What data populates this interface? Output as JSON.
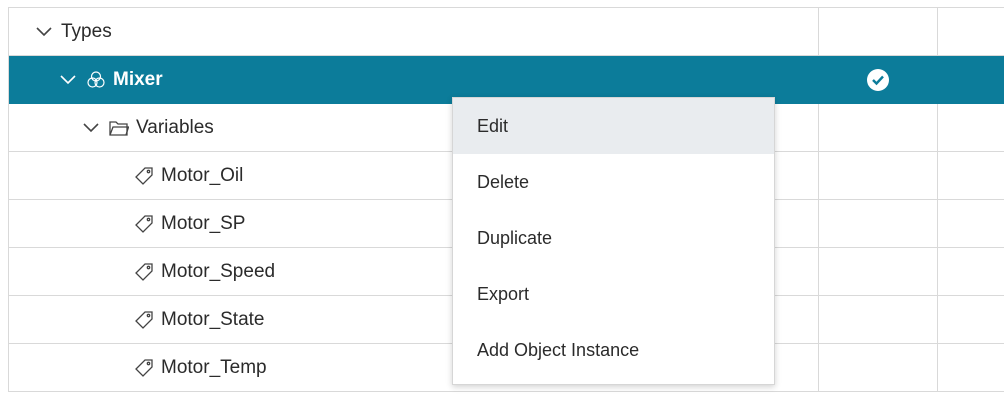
{
  "tree": {
    "rows": [
      {
        "label": "Types",
        "icon": "chevron-down-icon",
        "expanded": true
      },
      {
        "label": "Mixer",
        "icon": "object-type-icon",
        "expanded": true,
        "selected": true,
        "status": "check-circle-icon"
      },
      {
        "label": "Variables",
        "icon": "folder-icon",
        "expanded": true
      },
      {
        "label": "Motor_Oil",
        "icon": "tag-icon"
      },
      {
        "label": "Motor_SP",
        "icon": "tag-icon"
      },
      {
        "label": "Motor_Speed",
        "icon": "tag-icon"
      },
      {
        "label": "Motor_State",
        "icon": "tag-icon"
      },
      {
        "label": "Motor_Temp",
        "icon": "tag-icon"
      }
    ]
  },
  "context_menu": {
    "items": [
      {
        "label": "Edit",
        "hovered": true
      },
      {
        "label": "Delete"
      },
      {
        "label": "Duplicate"
      },
      {
        "label": "Export"
      },
      {
        "label": "Add Object Instance"
      }
    ]
  },
  "colors": {
    "selected_row": "#0c7c9a",
    "menu_hover": "#e9ecef",
    "grid_line": "#d9d9d9"
  }
}
